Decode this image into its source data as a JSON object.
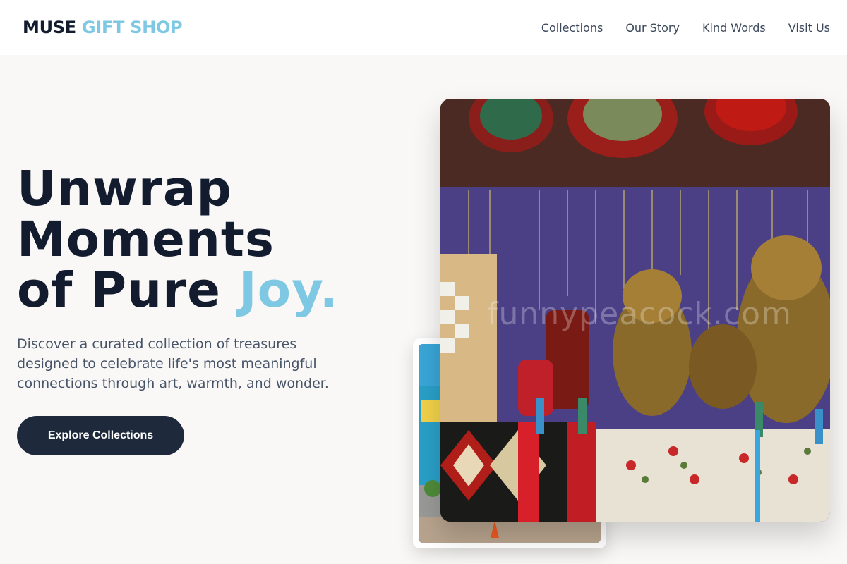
{
  "header": {
    "logo_part1": "MUSE",
    "logo_part2": "GIFT SHOP",
    "nav": [
      "Collections",
      "Our Story",
      "Kind Words",
      "Visit Us"
    ]
  },
  "hero": {
    "headline_line1": "Unwrap",
    "headline_line2": "Moments",
    "headline_line3": "of Pure",
    "headline_accent": "Joy.",
    "description": "Discover a curated collection of treasures designed to celebrate life's most meaningful connections through art, warmth, and wonder.",
    "cta_label": "Explore Collections"
  },
  "images": {
    "watermark": "funnypeacock.com"
  },
  "colors": {
    "accent": "#7ec8e3",
    "dark": "#131b2e",
    "button": "#1e293c"
  }
}
